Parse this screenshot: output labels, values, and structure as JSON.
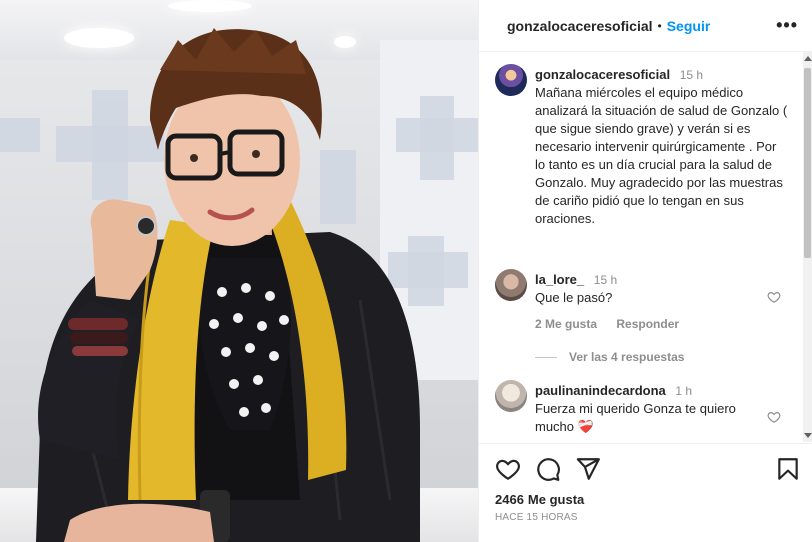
{
  "header": {
    "username": "gonzalocaceresoficial",
    "separator": "•",
    "follow_label": "Seguir",
    "more_label": "•••"
  },
  "caption": {
    "username": "gonzalocaceresoficial",
    "time": "15 h",
    "text": "Mañana miércoles el equipo médico analizará la situación de salud de Gonzalo ( que sigue siendo grave) y verán si es necesario intervenir quirúrgicamente . Por lo tanto es un día crucial para la salud de Gonzalo. Muy agradecido por las muestras de cariño pidió que lo tengan en sus oraciones."
  },
  "comments": [
    {
      "username": "la_lore_",
      "time": "15 h",
      "text": "Que le pasó?",
      "likes_label": "2 Me gusta",
      "reply_label": "Responder",
      "view_replies": "Ver las 4 respuestas"
    },
    {
      "username": "paulinanindecardona",
      "time": "1 h",
      "text": "Fuerza mi querido Gonza te quiero mucho",
      "emoji": "❤️‍🩹"
    }
  ],
  "stats": {
    "likes_count": "2466",
    "likes_suffix": "Me gusta",
    "posted_ago": "HACE 15 HORAS"
  },
  "icons": {
    "like": "heart-icon",
    "comment": "comment-icon",
    "share": "share-icon",
    "save": "bookmark-icon"
  },
  "colors": {
    "accent": "#0095f6",
    "text": "#262626",
    "muted": "#8e8e8e",
    "scarf": "#e3b82a"
  }
}
